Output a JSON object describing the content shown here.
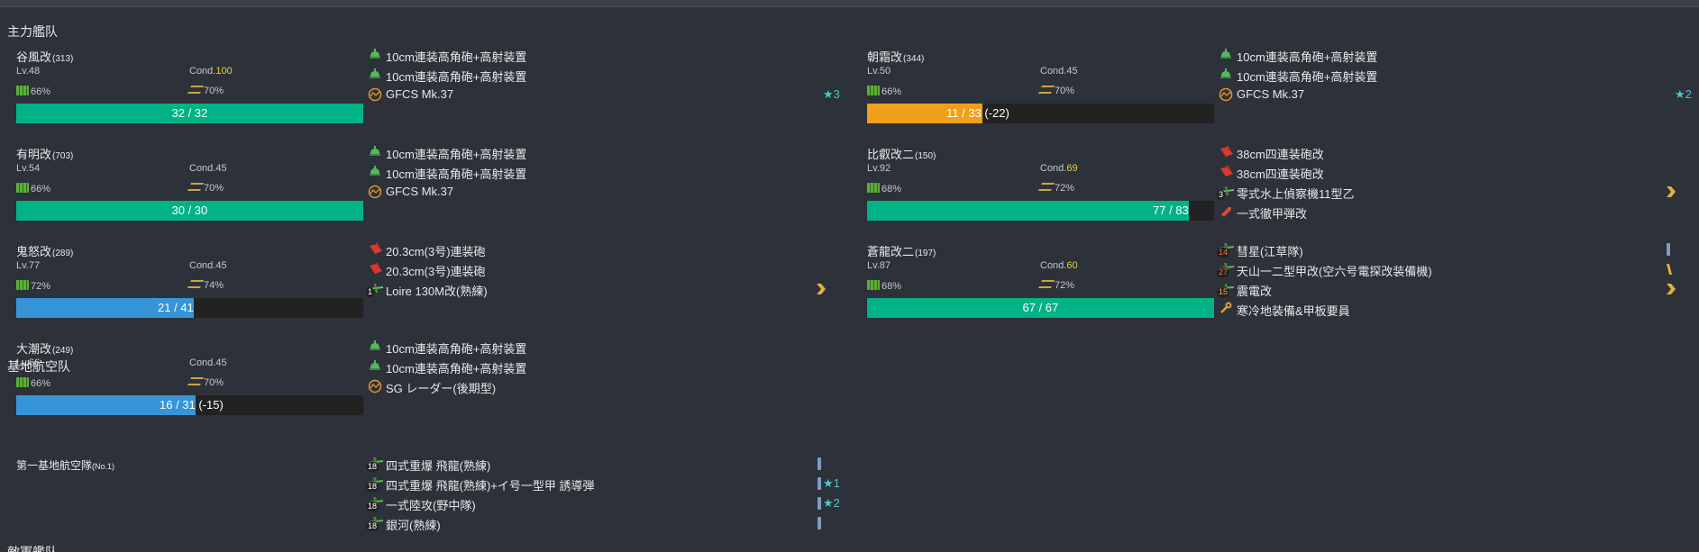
{
  "sections": {
    "main_fleet": "主力艦队",
    "lbas": "基地航空队",
    "third": "敵軍艦队"
  },
  "labels": {
    "lv": "Lv.",
    "cond": "Cond."
  },
  "colors": {
    "green": "#00b386",
    "orange": "#f0a01a",
    "blue": "#3694d8",
    "cond_good": "#e8d23c"
  },
  "ships": [
    {
      "name": "谷風改",
      "id": "(313)",
      "lv": "48",
      "cond": "100",
      "cond_good": true,
      "fuel": "66%",
      "ammo": "70%",
      "hp_text": "32 / 32",
      "hp_ratio": 1.0,
      "hp_color": "green",
      "equips": [
        {
          "name": "10cm連装高角砲+高射装置",
          "icon": "green-gun-icon"
        },
        {
          "name": "10cm連装高角砲+高射装置",
          "icon": "green-gun-icon"
        },
        {
          "name": "GFCS Mk.37",
          "icon": "radar-icon",
          "star": "★3"
        }
      ]
    },
    {
      "name": "朝霜改",
      "id": "(344)",
      "lv": "50",
      "cond": "45",
      "cond_good": false,
      "fuel": "66%",
      "ammo": "70%",
      "hp_text": "11 / 33 (-22)",
      "hp_ratio": 0.333,
      "hp_color": "orange",
      "equips": [
        {
          "name": "10cm連装高角砲+高射装置",
          "icon": "green-gun-icon"
        },
        {
          "name": "10cm連装高角砲+高射装置",
          "icon": "green-gun-icon"
        },
        {
          "name": "GFCS Mk.37",
          "icon": "radar-icon",
          "star": "★2"
        }
      ]
    },
    {
      "name": "有明改",
      "id": "(703)",
      "lv": "54",
      "cond": "45",
      "cond_good": false,
      "fuel": "66%",
      "ammo": "70%",
      "hp_text": "30 / 30",
      "hp_ratio": 1.0,
      "hp_color": "green",
      "equips": [
        {
          "name": "10cm連装高角砲+高射装置",
          "icon": "green-gun-icon"
        },
        {
          "name": "10cm連装高角砲+高射装置",
          "icon": "green-gun-icon"
        },
        {
          "name": "GFCS Mk.37",
          "icon": "radar-icon"
        }
      ]
    },
    {
      "name": "比叡改二",
      "id": "(150)",
      "lv": "92",
      "cond": "69",
      "cond_good": true,
      "fuel": "68%",
      "ammo": "72%",
      "hp_text": "77 / 83",
      "hp_ratio": 0.928,
      "hp_color": "green",
      "equips": [
        {
          "name": "38cm四連装砲改",
          "icon": "red-gun-icon"
        },
        {
          "name": "38cm四連装砲改",
          "icon": "red-gun-icon"
        },
        {
          "name": "零式水上偵察機11型乙",
          "icon": "seaplane-icon",
          "slot": "3",
          "prof": "chevron"
        },
        {
          "name": "一式徹甲弾改",
          "icon": "shell-icon"
        }
      ]
    },
    {
      "name": "鬼怒改",
      "id": "(289)",
      "lv": "77",
      "cond": "45",
      "cond_good": false,
      "fuel": "72%",
      "ammo": "74%",
      "hp_text": "21 / 41",
      "hp_ratio": 0.512,
      "hp_color": "blue",
      "equips": [
        {
          "name": "20.3cm(3号)連装砲",
          "icon": "red-gun-icon"
        },
        {
          "name": "20.3cm(3号)連装砲",
          "icon": "red-gun-icon"
        },
        {
          "name": "Loire 130M改(熟練)",
          "icon": "seaplane-icon",
          "slot": "1",
          "prof": "chevron"
        }
      ]
    },
    {
      "name": "蒼龍改二",
      "id": "(197)",
      "lv": "87",
      "cond": "60",
      "cond_good": true,
      "fuel": "68%",
      "ammo": "72%",
      "hp_text": "67 / 67",
      "hp_ratio": 1.0,
      "hp_color": "green",
      "equips": [
        {
          "name": "彗星(江草隊)",
          "icon": "bomber-icon",
          "slot": "14",
          "slot_color": "red",
          "prof": "bar"
        },
        {
          "name": "天山一二型甲改(空六号電探改装備機)",
          "icon": "bomber-icon",
          "slot": "27",
          "slot_color": "red",
          "prof": "slash"
        },
        {
          "name": "震電改",
          "icon": "fighter-icon",
          "slot": "15",
          "slot_color": "orange",
          "prof": "chevron"
        },
        {
          "name": "寒冷地装備&甲板要員",
          "icon": "wrench-icon"
        }
      ]
    },
    {
      "name": "大潮改",
      "id": "(249)",
      "lv": "66",
      "cond": "45",
      "cond_good": false,
      "fuel": "66%",
      "ammo": "70%",
      "hp_text": "16 / 31 (-15)",
      "hp_ratio": 0.516,
      "hp_color": "blue",
      "equips": [
        {
          "name": "10cm連装高角砲+高射装置",
          "icon": "green-gun-icon"
        },
        {
          "name": "10cm連装高角砲+高射装置",
          "icon": "green-gun-icon"
        },
        {
          "name": "SG レーダー(後期型)",
          "icon": "radar-icon"
        }
      ]
    }
  ],
  "lbas": {
    "name": "第一基地航空隊",
    "no": "(No.1)",
    "equips": [
      {
        "name": "四式重爆 飛龍(熟練)",
        "slot": "18",
        "prof": "bar"
      },
      {
        "name": "四式重爆 飛龍(熟練)+イ号一型甲 誘導弾",
        "slot": "18",
        "prof": "bar",
        "star": "★1"
      },
      {
        "name": "一式陸攻(野中隊)",
        "slot": "18",
        "prof": "bar",
        "star": "★2"
      },
      {
        "name": "銀河(熟練)",
        "slot": "18",
        "prof": "bar"
      }
    ]
  }
}
